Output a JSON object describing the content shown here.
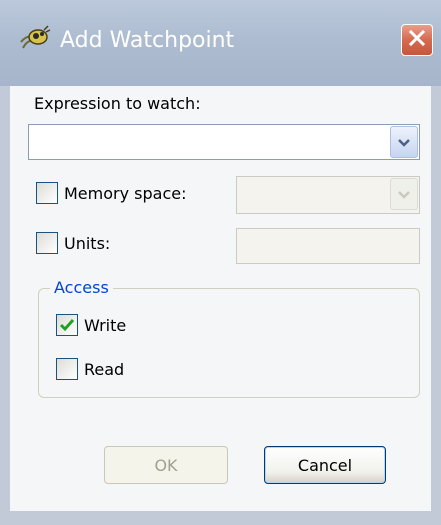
{
  "window": {
    "title": "Add Watchpoint",
    "title_icon": "debug-bug-icon",
    "close_icon": "close-icon"
  },
  "expression": {
    "label": "Expression to watch:",
    "value": ""
  },
  "memory_space": {
    "label": "Memory space:",
    "checked": false,
    "value": ""
  },
  "units": {
    "label": "Units:",
    "checked": false,
    "value": ""
  },
  "access": {
    "legend": "Access",
    "write_label": "Write",
    "write_checked": true,
    "read_label": "Read",
    "read_checked": false
  },
  "buttons": {
    "ok_label": "OK",
    "cancel_label": "Cancel"
  },
  "colors": {
    "title_bar": "#a6b5cb",
    "close_button": "#d56a4f",
    "group_legend": "#0046d5",
    "checkmark": "#21a121",
    "checkbox_border": "#1c5180"
  }
}
